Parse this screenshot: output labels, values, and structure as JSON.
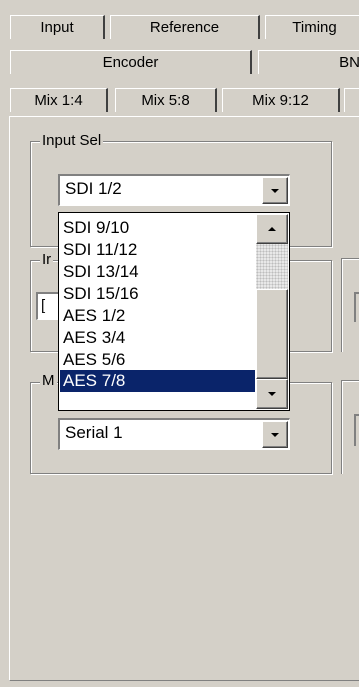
{
  "tabs": {
    "row1": [
      "Input",
      "Reference",
      "Timing"
    ],
    "row2": [
      "Encoder",
      "BN"
    ],
    "row3": [
      "Mix 1:4",
      "Mix 5:8",
      "Mix 9:12"
    ]
  },
  "input_sel": {
    "legend": "Input Sel",
    "selected": "SDI 1/2",
    "options": [
      "SDI 9/10",
      "SDI 11/12",
      "SDI 13/14",
      "SDI 15/16",
      "AES 1/2",
      "AES 3/4",
      "AES 5/6",
      "AES 7/8"
    ],
    "highlighted": "AES 7/8"
  },
  "group2": {
    "legend_partial": "Ir",
    "field_partial": "["
  },
  "group3": {
    "legend_partial": "M",
    "selected": "Serial 1"
  },
  "colors": {
    "selection": "#0a246a",
    "face": "#d4d0c8"
  }
}
